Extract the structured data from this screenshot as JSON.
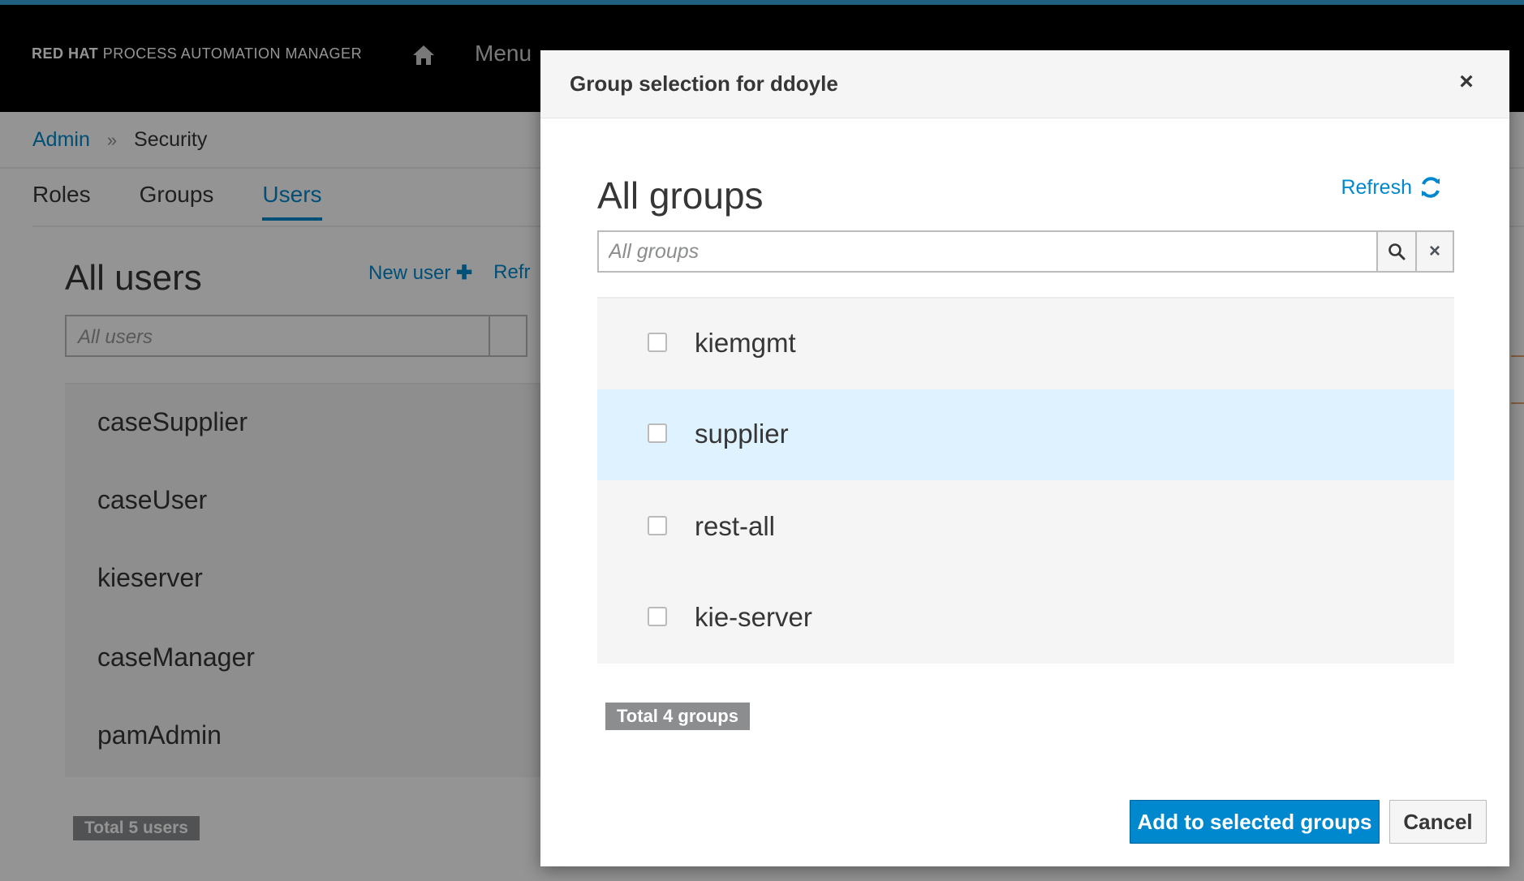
{
  "masthead": {
    "brand_bold": "RED HAT",
    "brand_light": "PROCESS AUTOMATION MANAGER",
    "home_icon": "home-icon",
    "menu_label": "Menu"
  },
  "breadcrumb": {
    "admin": "Admin",
    "separator": "»",
    "current": "Security"
  },
  "tabs": [
    {
      "label": "Roles",
      "active": false
    },
    {
      "label": "Groups",
      "active": false
    },
    {
      "label": "Users",
      "active": true
    }
  ],
  "users_panel": {
    "title": "All users",
    "new_user": "New user",
    "refresh": "Refr",
    "search_placeholder": "All users",
    "items": [
      "caseSupplier",
      "caseUser",
      "kieserver",
      "caseManager",
      "pamAdmin"
    ],
    "total": "Total 5 users"
  },
  "modal": {
    "title": "Group selection for ddoyle",
    "close_icon": "close-icon",
    "groups_title": "All groups",
    "refresh_label": "Refresh",
    "search_placeholder": "All groups",
    "groups": [
      {
        "name": "kiemgmt",
        "checked": false
      },
      {
        "name": "supplier",
        "checked": false,
        "hovered": true
      },
      {
        "name": "rest-all",
        "checked": false
      },
      {
        "name": "kie-server",
        "checked": false
      }
    ],
    "total": "Total 4 groups",
    "add_button": "Add to selected groups",
    "cancel_button": "Cancel"
  },
  "colors": {
    "accent": "#0088ce",
    "masthead": "#000000",
    "hover_row": "#def3ff",
    "badge": "#8b8d8f"
  }
}
